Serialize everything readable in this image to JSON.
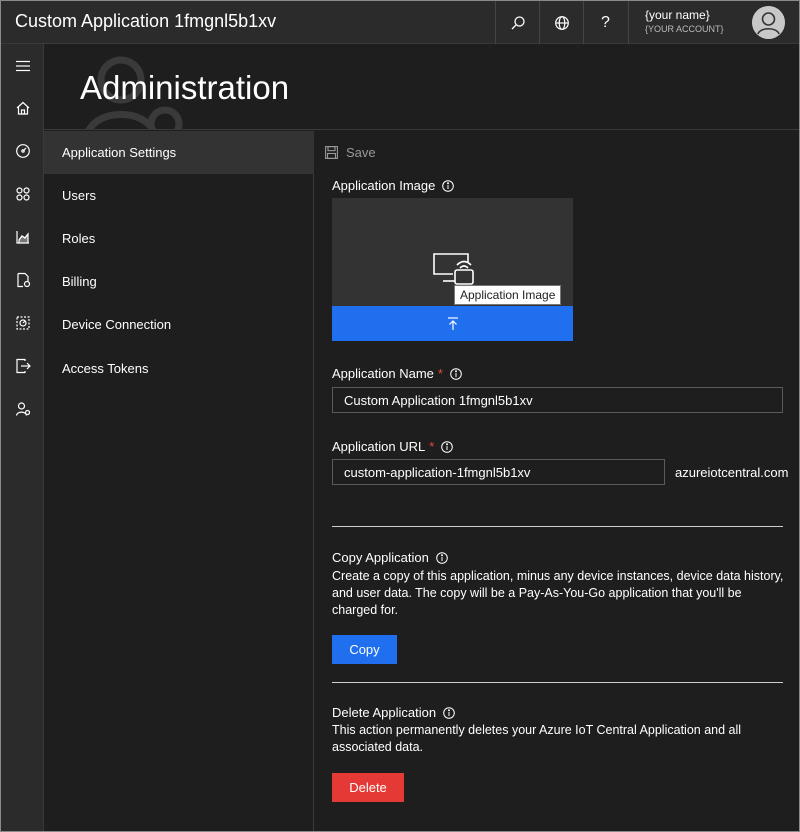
{
  "app": {
    "title": "Custom Application 1fmgnl5b1xv"
  },
  "topbar": {
    "icons": [
      "search-icon",
      "globe-icon",
      "help-icon"
    ],
    "help_label": "?",
    "user": {
      "name": "{your name}",
      "account": "{YOUR ACCOUNT}"
    }
  },
  "rail": {
    "items": [
      "menu-icon",
      "home-icon",
      "dashboard-icon",
      "devices-icon",
      "analytics-icon",
      "jobs-icon",
      "device-templates-icon",
      "data-export-icon",
      "administration-icon"
    ]
  },
  "header": {
    "title": "Administration"
  },
  "nav": {
    "items": [
      {
        "label": "Application Settings",
        "active": true
      },
      {
        "label": "Users",
        "active": false
      },
      {
        "label": "Roles",
        "active": false
      },
      {
        "label": "Billing",
        "active": false
      },
      {
        "label": "Device Connection",
        "active": false
      },
      {
        "label": "Access Tokens",
        "active": false
      }
    ]
  },
  "main": {
    "save_label": "Save",
    "image_section": {
      "label": "Application Image",
      "tooltip": "Application Image"
    },
    "app_name": {
      "label": "Application Name",
      "required_mark": "*",
      "value": "Custom Application 1fmgnl5b1xv"
    },
    "app_url": {
      "label": "Application URL",
      "required_mark": "*",
      "value": "custom-application-1fmgnl5b1xv",
      "suffix": "azureiotcentral.com"
    },
    "copy": {
      "title": "Copy Application",
      "description": "Create a copy of this application, minus any device instances, device data history, and user data. The copy will be a Pay-As-You-Go application that you'll be charged for.",
      "button": "Copy"
    },
    "delete": {
      "title": "Delete Application",
      "description": "This action permanently deletes your Azure IoT Central Application and all associated data.",
      "button": "Delete"
    }
  },
  "colors": {
    "accent": "#1f6fef",
    "danger": "#e53935",
    "background": "#1e1e1e",
    "chrome": "#2b2b2b"
  }
}
